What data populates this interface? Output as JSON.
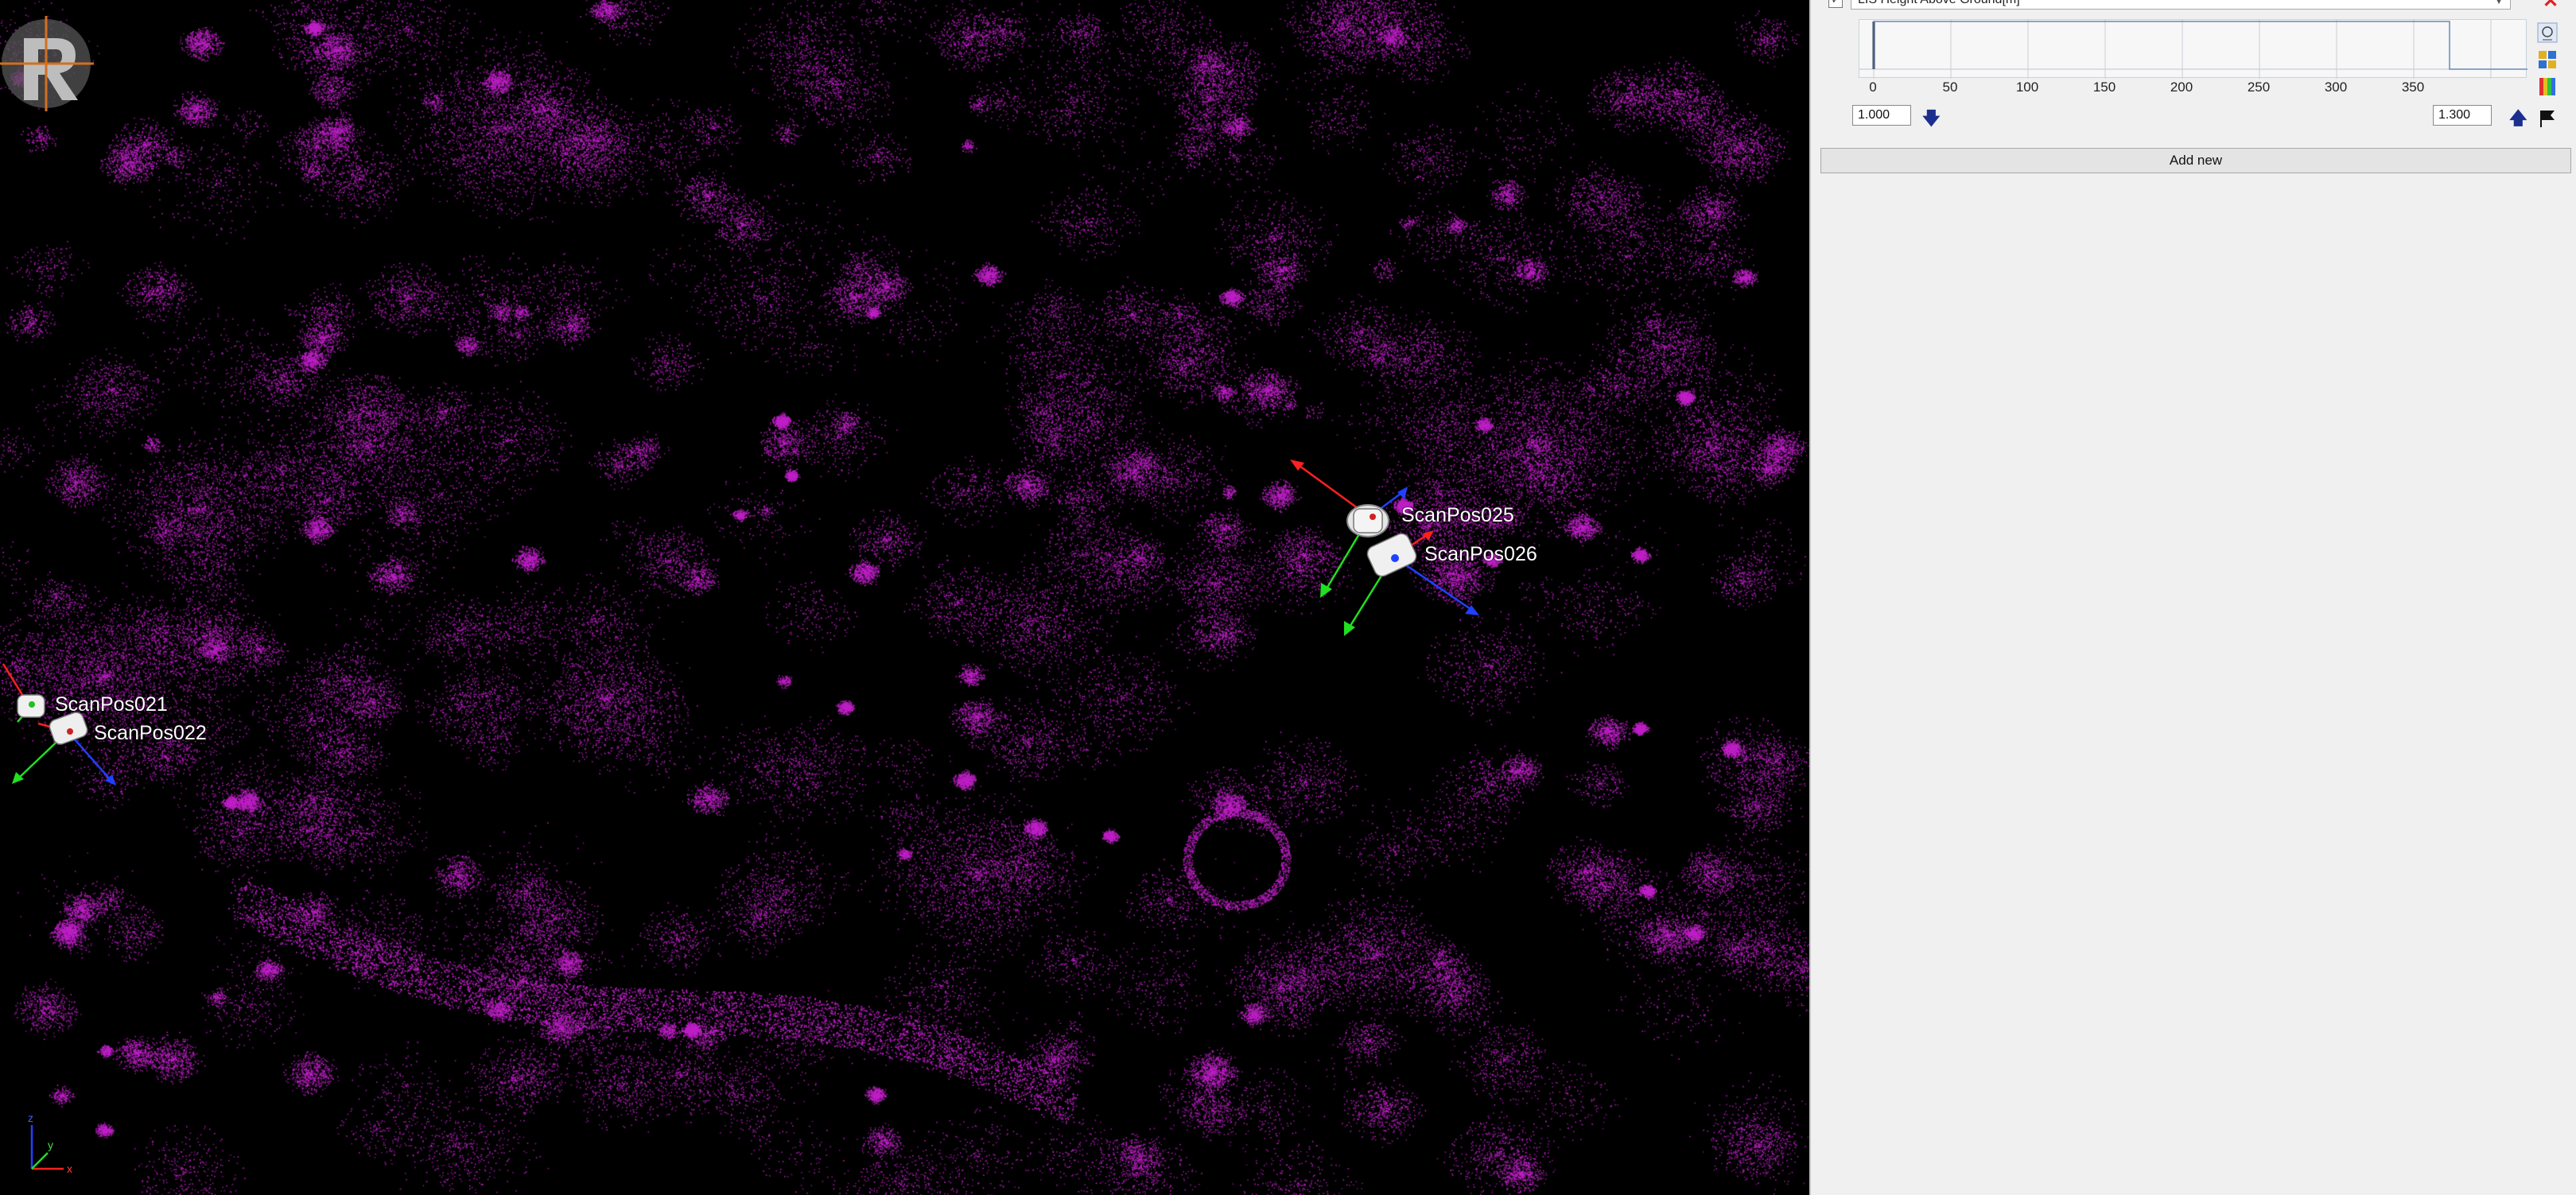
{
  "viewport": {
    "background": "#000000",
    "point_color": "#c020c8",
    "logo_icon": "riegl-logo-icon",
    "axis_colors": {
      "x": "#ff2020",
      "y": "#20e020",
      "z": "#2040ff"
    },
    "scan_positions": [
      {
        "label": "ScanPos025"
      },
      {
        "label": "ScanPos026"
      },
      {
        "label": "ScanPos021"
      },
      {
        "label": "ScanPos022"
      }
    ],
    "triad_labels": {
      "x": "x",
      "y": "y",
      "z": "z"
    }
  },
  "filter_panel": {
    "enabled": true,
    "attribute": "LIS Height Above Ground[m]",
    "histogram_ticks": [
      "0",
      "50",
      "100",
      "150",
      "200",
      "250",
      "300",
      "350"
    ],
    "min_value": "1.000",
    "max_value": "1.300",
    "add_new_label": "Add new",
    "close_color": "#e02020"
  }
}
